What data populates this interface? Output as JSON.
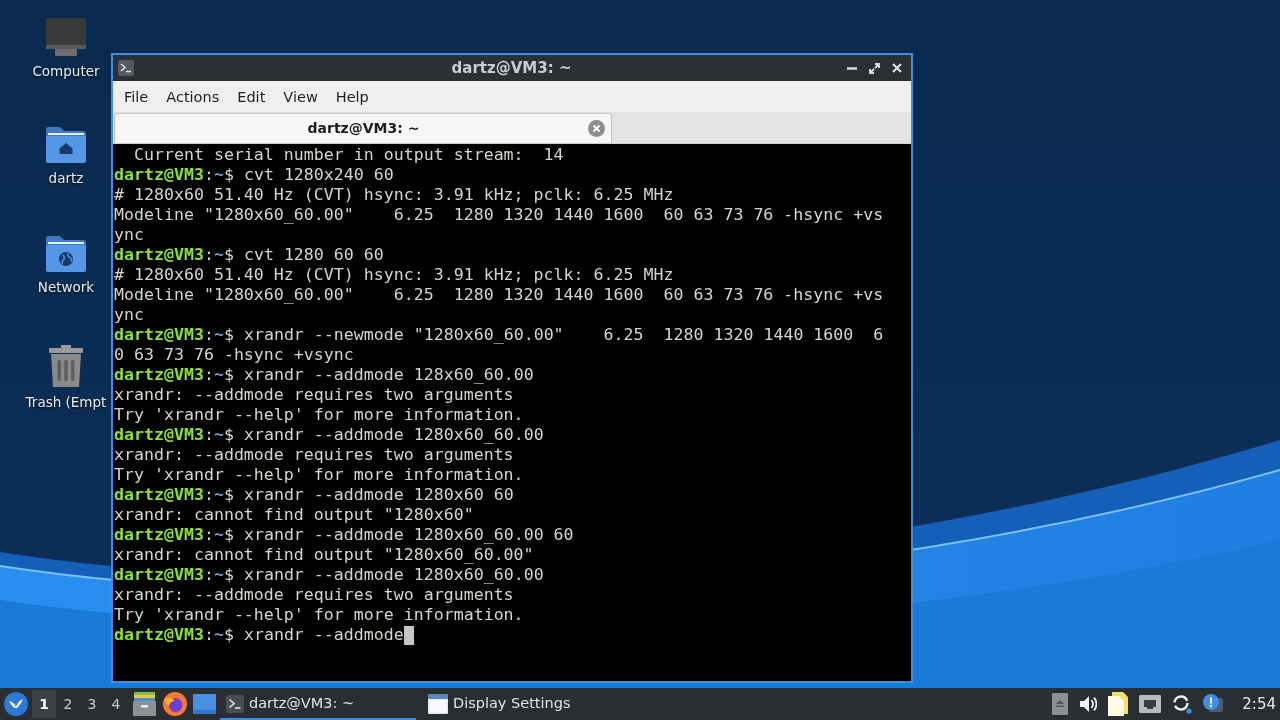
{
  "desktop_icons": [
    {
      "kind": "computer",
      "label": "Computer"
    },
    {
      "kind": "home",
      "label": "dartz"
    },
    {
      "kind": "network",
      "label": "Network"
    },
    {
      "kind": "trash",
      "label": "Trash (Empt"
    }
  ],
  "window": {
    "title": "dartz@VM3: ~",
    "menu": [
      "File",
      "Actions",
      "Edit",
      "View",
      "Help"
    ],
    "tabs": [
      {
        "label": "dartz@VM3: ~",
        "selected": true
      }
    ],
    "terminal": {
      "cursor": true,
      "lines": [
        {
          "kind": "output",
          "text": "  Current serial number in output stream:  14"
        },
        {
          "kind": "prompt",
          "user": "dartz@VM3",
          "sep": ":",
          "path": "~",
          "sign": "$",
          "command": "cvt 1280x240 60"
        },
        {
          "kind": "output",
          "text": "# 1280x60 51.40 Hz (CVT) hsync: 3.91 kHz; pclk: 6.25 MHz"
        },
        {
          "kind": "output",
          "text": "Modeline \"1280x60_60.00\"    6.25  1280 1320 1440 1600  60 63 73 76 -hsync +vs"
        },
        {
          "kind": "output",
          "text": "ync"
        },
        {
          "kind": "prompt",
          "user": "dartz@VM3",
          "sep": ":",
          "path": "~",
          "sign": "$",
          "command": "cvt 1280 60 60"
        },
        {
          "kind": "output",
          "text": "# 1280x60 51.40 Hz (CVT) hsync: 3.91 kHz; pclk: 6.25 MHz"
        },
        {
          "kind": "output",
          "text": "Modeline \"1280x60_60.00\"    6.25  1280 1320 1440 1600  60 63 73 76 -hsync +vs"
        },
        {
          "kind": "output",
          "text": "ync"
        },
        {
          "kind": "prompt",
          "user": "dartz@VM3",
          "sep": ":",
          "path": "~",
          "sign": "$",
          "command": "xrandr --newmode \"1280x60_60.00\"    6.25  1280 1320 1440 1600  6"
        },
        {
          "kind": "output",
          "text": "0 63 73 76 -hsync +vsync"
        },
        {
          "kind": "prompt",
          "user": "dartz@VM3",
          "sep": ":",
          "path": "~",
          "sign": "$",
          "command": "xrandr --addmode 128x60_60.00"
        },
        {
          "kind": "output",
          "text": "xrandr: --addmode requires two arguments"
        },
        {
          "kind": "output",
          "text": "Try 'xrandr --help' for more information."
        },
        {
          "kind": "prompt",
          "user": "dartz@VM3",
          "sep": ":",
          "path": "~",
          "sign": "$",
          "command": "xrandr --addmode 1280x60_60.00"
        },
        {
          "kind": "output",
          "text": "xrandr: --addmode requires two arguments"
        },
        {
          "kind": "output",
          "text": "Try 'xrandr --help' for more information."
        },
        {
          "kind": "prompt",
          "user": "dartz@VM3",
          "sep": ":",
          "path": "~",
          "sign": "$",
          "command": "xrandr --addmode 1280x60 60"
        },
        {
          "kind": "output",
          "text": "xrandr: cannot find output \"1280x60\""
        },
        {
          "kind": "prompt",
          "user": "dartz@VM3",
          "sep": ":",
          "path": "~",
          "sign": "$",
          "command": "xrandr --addmode 1280x60_60.00 60"
        },
        {
          "kind": "output",
          "text": "xrandr: cannot find output \"1280x60_60.00\""
        },
        {
          "kind": "prompt",
          "user": "dartz@VM3",
          "sep": ":",
          "path": "~",
          "sign": "$",
          "command": "xrandr --addmode 1280x60_60.00"
        },
        {
          "kind": "output",
          "text": "xrandr: --addmode requires two arguments"
        },
        {
          "kind": "output",
          "text": "Try 'xrandr --help' for more information."
        },
        {
          "kind": "prompt",
          "user": "dartz@VM3",
          "sep": ":",
          "path": "~",
          "sign": "$",
          "command": "xrandr --addmode"
        }
      ]
    }
  },
  "taskbar": {
    "workspaces": [
      {
        "label": "1",
        "selected": true
      },
      {
        "label": "2",
        "selected": false
      },
      {
        "label": "3",
        "selected": false
      },
      {
        "label": "4",
        "selected": false
      }
    ],
    "tasks": [
      {
        "kind": "terminal",
        "label": "dartz@VM3: ~",
        "selected": true
      },
      {
        "kind": "window",
        "label": "Display Settings",
        "selected": false
      }
    ],
    "clock": "2:54"
  }
}
